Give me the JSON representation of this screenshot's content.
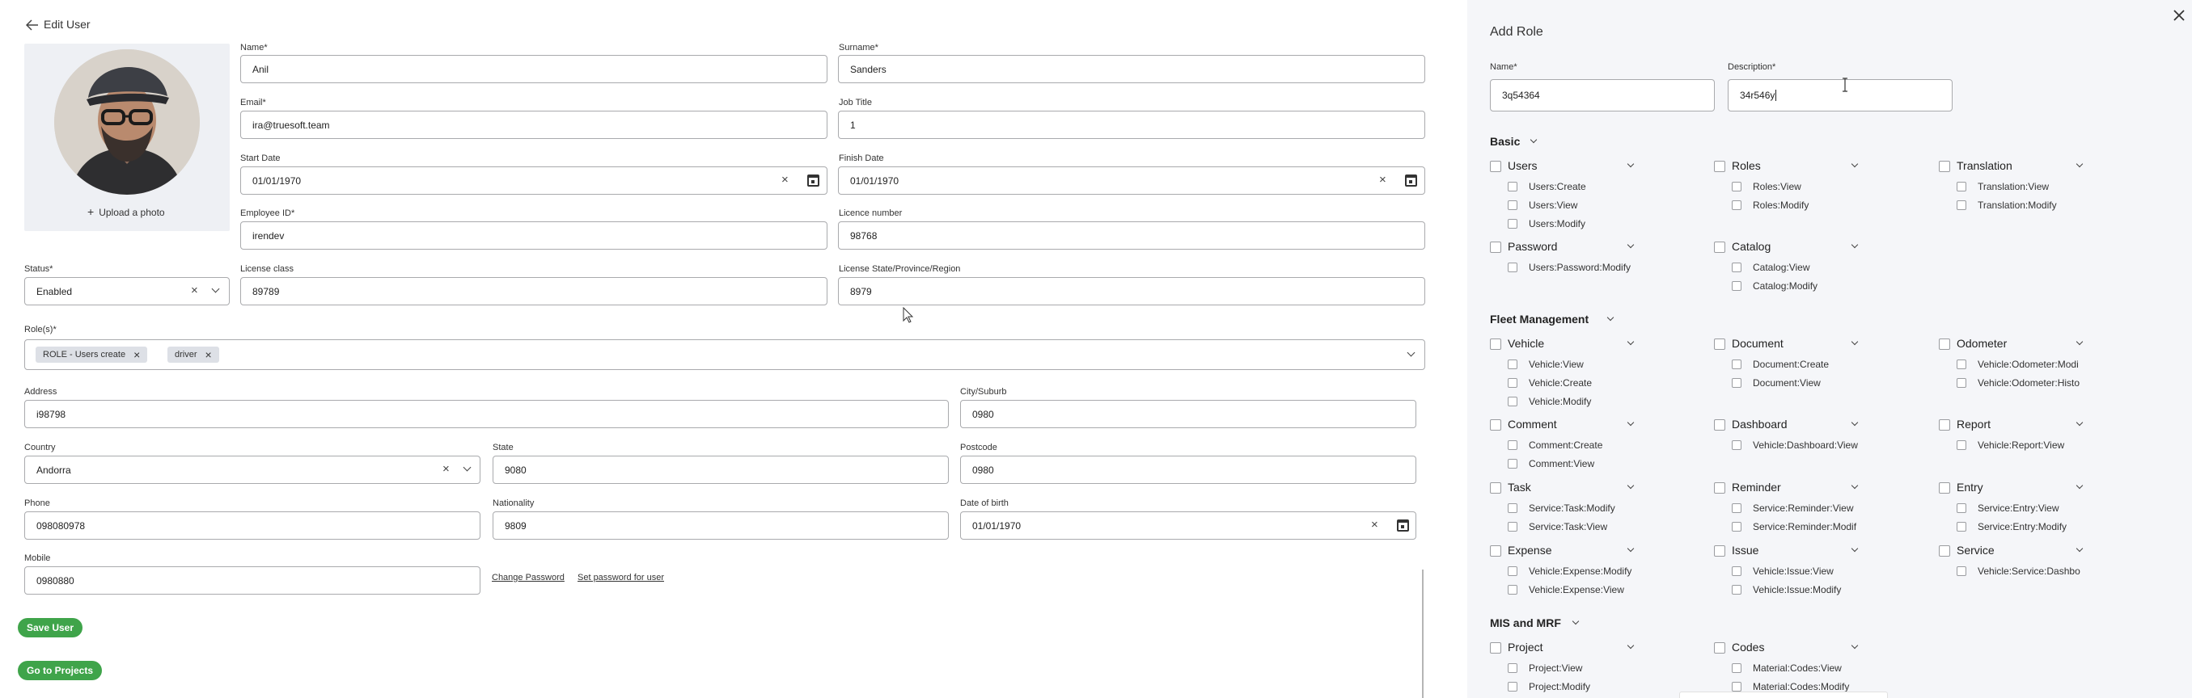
{
  "edit_user": {
    "back_title": "Edit User",
    "upload_photo": "Upload a photo",
    "status": {
      "label": "Status*",
      "value": "Enabled"
    },
    "fields": {
      "name": {
        "label": "Name*",
        "value": "Anil"
      },
      "surname": {
        "label": "Surname*",
        "value": "Sanders"
      },
      "email": {
        "label": "Email*",
        "value": "ira@truesoft.team"
      },
      "job_title": {
        "label": "Job Title",
        "value": "1"
      },
      "start_date": {
        "label": "Start Date",
        "value": "01/01/1970"
      },
      "finish_date": {
        "label": "Finish Date",
        "value": "01/01/1970"
      },
      "employee_id": {
        "label": "Employee ID*",
        "value": "irendev"
      },
      "licence_number": {
        "label": "Licence number",
        "value": "98768"
      },
      "license_class": {
        "label": "License class",
        "value": "89789"
      },
      "license_state": {
        "label": "License State/Province/Region",
        "value": "8979"
      },
      "address": {
        "label": "Address",
        "value": "i98798"
      },
      "city": {
        "label": "City/Suburb",
        "value": "0980"
      },
      "country": {
        "label": "Country",
        "value": "Andorra"
      },
      "state": {
        "label": "State",
        "value": "9080"
      },
      "postcode": {
        "label": "Postcode",
        "value": "0980"
      },
      "phone": {
        "label": "Phone",
        "value": "098080978"
      },
      "nationality": {
        "label": "Nationality",
        "value": "9809"
      },
      "dob": {
        "label": "Date of birth",
        "value": "01/01/1970"
      },
      "mobile": {
        "label": "Mobile",
        "value": "0980880"
      }
    },
    "roles": {
      "label": "Role(s)*",
      "chips": [
        "ROLE - Users create",
        "driver"
      ]
    },
    "change_password": "Change Password",
    "set_password": "Set password for user",
    "save_user": "Save User",
    "go_to_projects": "Go to Projects"
  },
  "add_role": {
    "title": "Add Role",
    "name": {
      "label": "Name*",
      "value": "3q54364"
    },
    "description": {
      "label": "Description*",
      "value": "34r546y"
    },
    "sections": [
      {
        "title": "Basic",
        "groups": [
          {
            "title": "Users",
            "perms": [
              "Users:Create",
              "Users:View",
              "Users:Modify"
            ]
          },
          {
            "title": "Roles",
            "perms": [
              "Roles:View",
              "Roles:Modify"
            ]
          },
          {
            "title": "Translation",
            "perms": [
              "Translation:View",
              "Translation:Modify"
            ]
          },
          {
            "title": "Password",
            "perms": [
              "Users:Password:Modify"
            ]
          },
          {
            "title": "Catalog",
            "perms": [
              "Catalog:View",
              "Catalog:Modify"
            ]
          }
        ]
      },
      {
        "title": "Fleet Management",
        "groups": [
          {
            "title": "Vehicle",
            "perms": [
              "Vehicle:View",
              "Vehicle:Create",
              "Vehicle:Modify"
            ]
          },
          {
            "title": "Document",
            "perms": [
              "Document:Create",
              "Document:View"
            ]
          },
          {
            "title": "Odometer",
            "perms": [
              "Vehicle:Odometer:Modi",
              "Vehicle:Odometer:Histo"
            ]
          },
          {
            "title": "Comment",
            "perms": [
              "Comment:Create",
              "Comment:View"
            ]
          },
          {
            "title": "Dashboard",
            "perms": [
              "Vehicle:Dashboard:View"
            ]
          },
          {
            "title": "Report",
            "perms": [
              "Vehicle:Report:View"
            ]
          },
          {
            "title": "Task",
            "perms": [
              "Service:Task:Modify",
              "Service:Task:View"
            ]
          },
          {
            "title": "Reminder",
            "perms": [
              "Service:Reminder:View",
              "Service:Reminder:Modif"
            ]
          },
          {
            "title": "Entry",
            "perms": [
              "Service:Entry:View",
              "Service:Entry:Modify"
            ]
          },
          {
            "title": "Expense",
            "perms": [
              "Vehicle:Expense:Modify",
              "Vehicle:Expense:View"
            ]
          },
          {
            "title": "Issue",
            "perms": [
              "Vehicle:Issue:View",
              "Vehicle:Issue:Modify"
            ]
          },
          {
            "title": "Service",
            "perms": [
              "Vehicle:Service:Dashbo"
            ]
          }
        ]
      },
      {
        "title": "MIS and MRF",
        "groups": [
          {
            "title": "Project",
            "perms": [
              "Project:View",
              "Project:Modify"
            ]
          },
          {
            "title": "Codes",
            "perms": [
              "Material:Codes:View",
              "Material:Codes:Modify"
            ]
          }
        ]
      }
    ]
  }
}
